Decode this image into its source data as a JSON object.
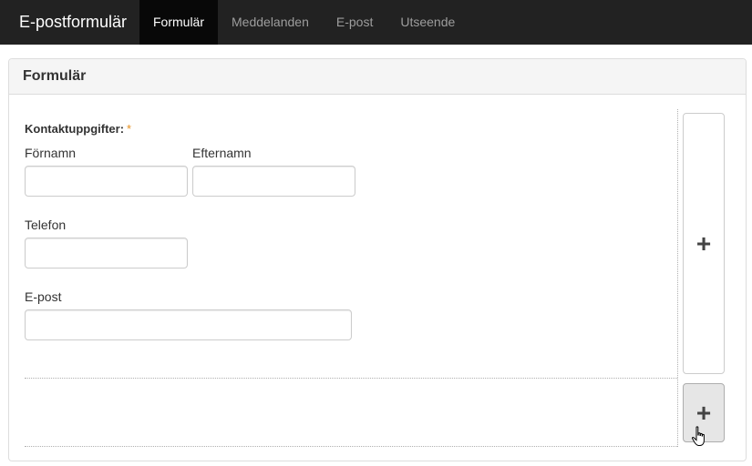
{
  "navbar": {
    "brand": "E-postformulär",
    "tabs": [
      {
        "label": "Formulär",
        "active": true
      },
      {
        "label": "Meddelanden",
        "active": false
      },
      {
        "label": "E-post",
        "active": false
      },
      {
        "label": "Utseende",
        "active": false
      }
    ]
  },
  "panel": {
    "title": "Formulär"
  },
  "form": {
    "section_label": "Kontaktuppgifter:",
    "required_marker": "*",
    "fields": {
      "first_name": {
        "label": "Förnamn",
        "value": ""
      },
      "last_name": {
        "label": "Efternamn",
        "value": ""
      },
      "phone": {
        "label": "Telefon",
        "value": ""
      },
      "email": {
        "label": "E-post",
        "value": ""
      }
    }
  },
  "actions": {
    "add_column_symbol": "+",
    "add_row_symbol": "+"
  },
  "colors": {
    "navbar_bg": "#222222",
    "nav_active_bg": "#080808",
    "required_color": "#e69020",
    "panel_heading_bg": "#f5f5f5"
  },
  "icons": {
    "add": "plus-icon",
    "cursor": "hand-pointer-icon"
  }
}
